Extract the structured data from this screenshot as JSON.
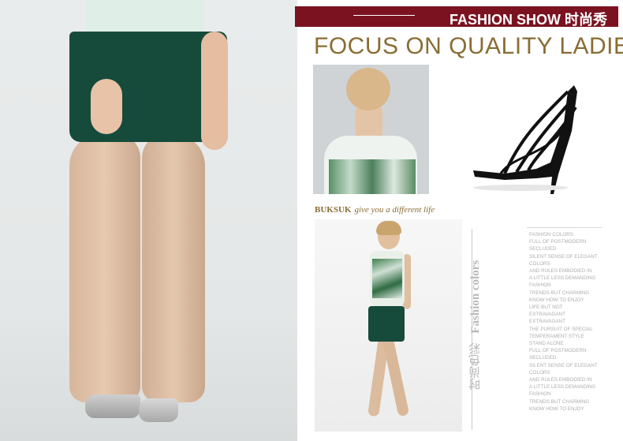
{
  "banner": {
    "title": "FASHION SHOW 时尚秀",
    "bg_color": "#7a1220"
  },
  "headline": "FOCUS ON QUALITY LADIES",
  "brand_line": {
    "brand": "BUKSUK",
    "slogan": "give you a different life"
  },
  "vertical_title": {
    "english": "Fashion colors",
    "chinese": "时尚色彩"
  },
  "body_lines": [
    "FASHION COLORS",
    "FULL OF POSTMODERN",
    "SECLUDED",
    "SILENT SENSE OF ELEGANT",
    "COLORS",
    "AND RULES EMBODIED IN",
    "A LITTLE LESS DEMANDING",
    "FASHION",
    "TRENDS BUT CHARMING",
    "KNOW HOW TO ENJOY",
    "LIFE BUT NOT",
    "EXTRAVAGANT",
    "EXTRAVAGANT",
    "THE PURSUIT OF SPECIAL",
    "TEMPERAMENT STYLE",
    "STAND ALONE",
    "FULL OF POSTMODERN",
    "SECLUDED",
    "SILENT SENSE OF ELEGANT",
    "COLORS",
    "AND RULES EMBODIED IN",
    "A LITTLE LESS DEMANDING",
    "FASHION",
    "TRENDS BUT CHARMING",
    "KNOW HOW TO ENJOY"
  ],
  "colors": {
    "accent_gold": "#8a6d34",
    "shorts_green": "#164b3b"
  }
}
